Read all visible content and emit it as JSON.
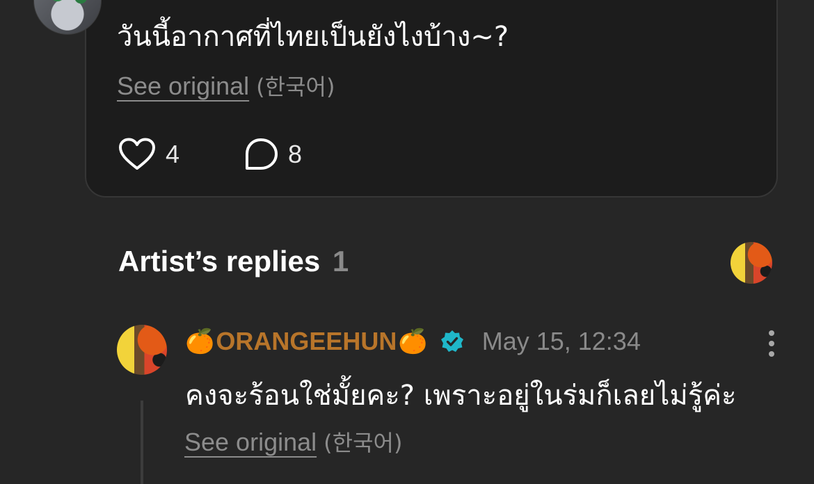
{
  "post": {
    "text": "วันนี้อากาศที่ไทยเป็นยังไงบ้าง~?",
    "see_original": "See original",
    "original_lang": "(한국어)",
    "likes": "4",
    "comments": "8"
  },
  "artist_replies": {
    "title": "Artist’s replies",
    "count": "1"
  },
  "reply": {
    "prefix_emoji": "🍊",
    "author": "ORANGEEHUN",
    "suffix_emoji": "🍊",
    "timestamp": "May 15, 12:34",
    "text": "คงจะร้อนใช่มั้ยคะ? เพราะอยู่ในร่มก็เลยไม่รู้ค่ะ",
    "see_original": "See original",
    "original_lang": "(한국어)"
  },
  "colors": {
    "background": "#262626",
    "card": "#1c1c1c",
    "artist_name": "#b8752a",
    "verified": "#1fb7c9",
    "muted": "#8c8c8c"
  },
  "icons": {
    "like": "heart-icon",
    "comment": "comment-bubble-icon",
    "verified": "verified-badge-icon",
    "more": "more-vertical-icon"
  }
}
